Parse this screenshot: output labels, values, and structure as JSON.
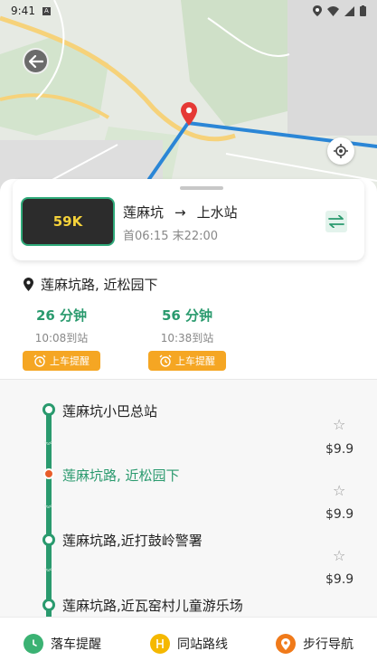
{
  "status_bar": {
    "time": "9:41",
    "badge": "A"
  },
  "route": {
    "number": "59K",
    "from": "莲麻坑",
    "arrow": "→",
    "to": "上水站",
    "hours": "首06:15 末22:00"
  },
  "current_stop": {
    "label": "莲麻坑路, 近松园下"
  },
  "etas": [
    {
      "minutes": "26 分钟",
      "arrival": "10:08到站",
      "remind": "上车提醒"
    },
    {
      "minutes": "56 分钟",
      "arrival": "10:38到站",
      "remind": "上车提醒"
    }
  ],
  "stops": [
    {
      "name": "莲麻坑小巴总站",
      "fare": "$9.9"
    },
    {
      "name": "莲麻坑路, 近松园下",
      "fare": "$9.9"
    },
    {
      "name": "莲麻坑路,近打鼓岭警署",
      "fare": "$9.9"
    },
    {
      "name": "莲麻坑路,近瓦窑村儿童游乐场",
      "fare": ""
    }
  ],
  "bottom_nav": [
    {
      "label": "落车提醒",
      "icon": "clock-icon",
      "color": "#3bb273"
    },
    {
      "label": "同站路线",
      "icon": "route-icon",
      "color": "#f5b800"
    },
    {
      "label": "步行导航",
      "icon": "walk-pin-icon",
      "color": "#f07a1a"
    }
  ],
  "colors": {
    "accent": "#2a9a6e",
    "remind": "#f5a623",
    "route_line": "#2b86d6",
    "marker": "#e53935"
  }
}
